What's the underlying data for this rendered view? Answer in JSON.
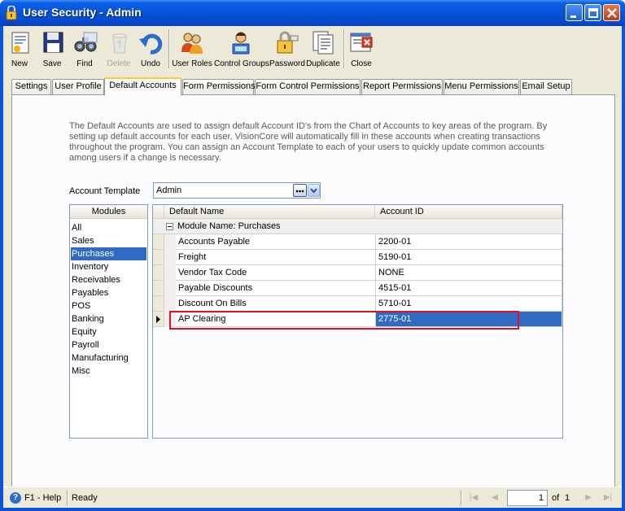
{
  "window": {
    "title": "User Security - Admin"
  },
  "toolbar": {
    "items": [
      {
        "label": "New",
        "icon": "new-document-icon",
        "enabled": true
      },
      {
        "label": "Save",
        "icon": "floppy-disk-icon",
        "enabled": true
      },
      {
        "label": "Find",
        "icon": "binoculars-icon",
        "enabled": true
      },
      {
        "label": "Delete",
        "icon": "recycle-bin-icon",
        "enabled": false
      },
      {
        "label": "Undo",
        "icon": "undo-arrow-icon",
        "enabled": true
      },
      {
        "label": "User Roles",
        "icon": "users-icon",
        "enabled": true
      },
      {
        "label": "Control Groups",
        "icon": "computer-user-icon",
        "enabled": true
      },
      {
        "label": "Password",
        "icon": "key-lock-icon",
        "enabled": true
      },
      {
        "label": "Duplicate",
        "icon": "duplicate-pages-icon",
        "enabled": true
      },
      {
        "label": "Close",
        "icon": "close-window-icon",
        "enabled": true
      }
    ]
  },
  "tabs": [
    {
      "label": "Settings",
      "active": false
    },
    {
      "label": "User Profile",
      "active": false
    },
    {
      "label": "Default Accounts",
      "active": true
    },
    {
      "label": "Form Permissions",
      "active": false
    },
    {
      "label": "Form Control Permissions",
      "active": false
    },
    {
      "label": "Report Permissions",
      "active": false
    },
    {
      "label": "Menu Permissions",
      "active": false
    },
    {
      "label": "Email Setup",
      "active": false
    }
  ],
  "default_accounts": {
    "description": "The Default Accounts are used to assign default Account ID's from the Chart of Accounts to key areas of the program.  By setting up default accounts for each user, VisionCore will automatically fill in these accounts when creating transactions throughout the program.  You can assign an Account Template to each of your users to quickly update common accounts among users if a change is necessary.",
    "template_label": "Account Template",
    "template_value": "Admin"
  },
  "modules": {
    "header": "Modules",
    "items": [
      "All",
      "Sales",
      "Purchases",
      "Inventory",
      "Receivables",
      "Payables",
      "POS",
      "Banking",
      "Equity",
      "Payroll",
      "Manufacturing",
      "Misc"
    ],
    "selected": "Purchases"
  },
  "grid": {
    "columns": [
      "Default Name",
      "Account ID"
    ],
    "group_label": "Module Name: Purchases",
    "rows": [
      {
        "name": "Accounts Payable",
        "account": "2200-01"
      },
      {
        "name": "Freight",
        "account": "5190-01"
      },
      {
        "name": "Vendor Tax Code",
        "account": "NONE"
      },
      {
        "name": "Payable Discounts",
        "account": "4515-01"
      },
      {
        "name": "Discount On Bills",
        "account": "5710-01"
      },
      {
        "name": "AP Clearing",
        "account": "2775-01"
      }
    ],
    "selected_row": "AP Clearing",
    "highlight_color": "#e0101c",
    "selection_color": "#316ac5"
  },
  "statusbar": {
    "help": "F1 - Help",
    "status": "Ready",
    "page": "1",
    "of_label": "of",
    "total_pages": "1"
  }
}
